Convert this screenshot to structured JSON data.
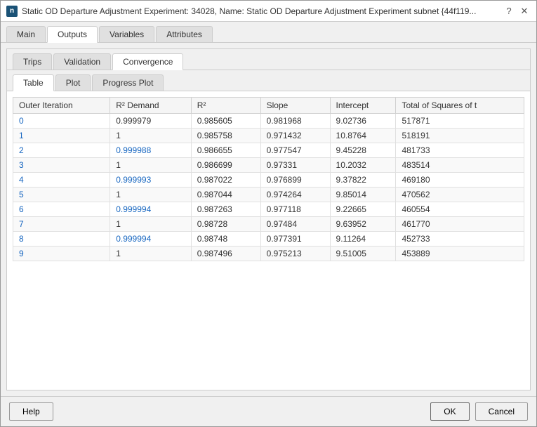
{
  "window": {
    "title": "Static OD Departure Adjustment Experiment: 34028, Name: Static OD Departure Adjustment Experiment subnet {44f119...",
    "icon": "n"
  },
  "main_tabs": [
    {
      "label": "Main",
      "active": false
    },
    {
      "label": "Outputs",
      "active": true
    },
    {
      "label": "Variables",
      "active": false
    },
    {
      "label": "Attributes",
      "active": false
    }
  ],
  "sub_tabs": [
    {
      "label": "Trips",
      "active": false
    },
    {
      "label": "Validation",
      "active": false
    },
    {
      "label": "Convergence",
      "active": true
    }
  ],
  "inner_tabs": [
    {
      "label": "Table",
      "active": true
    },
    {
      "label": "Plot",
      "active": false
    },
    {
      "label": "Progress Plot",
      "active": false
    }
  ],
  "table": {
    "headers": [
      "Outer Iteration",
      "R² Demand",
      "R²",
      "Slope",
      "Intercept",
      "Total of Squares of t"
    ],
    "rows": [
      {
        "iter": "0",
        "r2demand": "0.999979",
        "r2": "0.985605",
        "slope": "0.981968",
        "intercept": "9.02736",
        "total": "517871",
        "iter_blue": true,
        "r2d_blue": false
      },
      {
        "iter": "1",
        "r2demand": "1",
        "r2": "0.985758",
        "slope": "0.971432",
        "intercept": "10.8764",
        "total": "518191",
        "iter_blue": true,
        "r2d_blue": false
      },
      {
        "iter": "2",
        "r2demand": "0.999988",
        "r2": "0.986655",
        "slope": "0.977547",
        "intercept": "9.45228",
        "total": "481733",
        "iter_blue": true,
        "r2d_blue": true
      },
      {
        "iter": "3",
        "r2demand": "1",
        "r2": "0.986699",
        "slope": "0.97331",
        "intercept": "10.2032",
        "total": "483514",
        "iter_blue": true,
        "r2d_blue": false
      },
      {
        "iter": "4",
        "r2demand": "0.999993",
        "r2": "0.987022",
        "slope": "0.976899",
        "intercept": "9.37822",
        "total": "469180",
        "iter_blue": true,
        "r2d_blue": true
      },
      {
        "iter": "5",
        "r2demand": "1",
        "r2": "0.987044",
        "slope": "0.974264",
        "intercept": "9.85014",
        "total": "470562",
        "iter_blue": true,
        "r2d_blue": false
      },
      {
        "iter": "6",
        "r2demand": "0.999994",
        "r2": "0.987263",
        "slope": "0.977118",
        "intercept": "9.22665",
        "total": "460554",
        "iter_blue": true,
        "r2d_blue": true
      },
      {
        "iter": "7",
        "r2demand": "1",
        "r2": "0.98728",
        "slope": "0.97484",
        "intercept": "9.63952",
        "total": "461770",
        "iter_blue": true,
        "r2d_blue": false
      },
      {
        "iter": "8",
        "r2demand": "0.999994",
        "r2": "0.98748",
        "slope": "0.977391",
        "intercept": "9.11264",
        "total": "452733",
        "iter_blue": true,
        "r2d_blue": true
      },
      {
        "iter": "9",
        "r2demand": "1",
        "r2": "0.987496",
        "slope": "0.975213",
        "intercept": "9.51005",
        "total": "453889",
        "iter_blue": true,
        "r2d_blue": false
      }
    ]
  },
  "footer": {
    "help_label": "Help",
    "ok_label": "OK",
    "cancel_label": "Cancel"
  }
}
